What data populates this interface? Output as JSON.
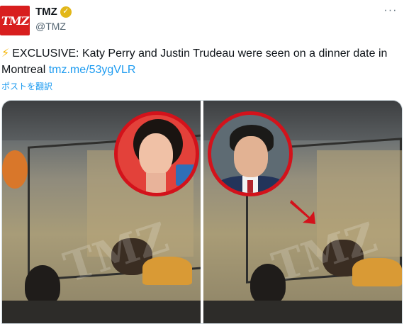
{
  "account": {
    "avatar_text": "TMZ",
    "display_name": "TMZ",
    "handle": "@TMZ",
    "verified_icon": "gold-check-badge"
  },
  "tweet": {
    "bolt_icon": "⚡",
    "text": "EXCLUSIVE: Katy Perry and Justin Trudeau were seen on a dinner date in Montreal",
    "link": "tmz.me/53ygVLR",
    "translate_label": "ポストを翻訳"
  },
  "media": {
    "watermark": "TMZ"
  },
  "colors": {
    "accent_link": "#1d9bf0",
    "brand_red": "#d81e1e",
    "circle_red": "#d3121b"
  }
}
